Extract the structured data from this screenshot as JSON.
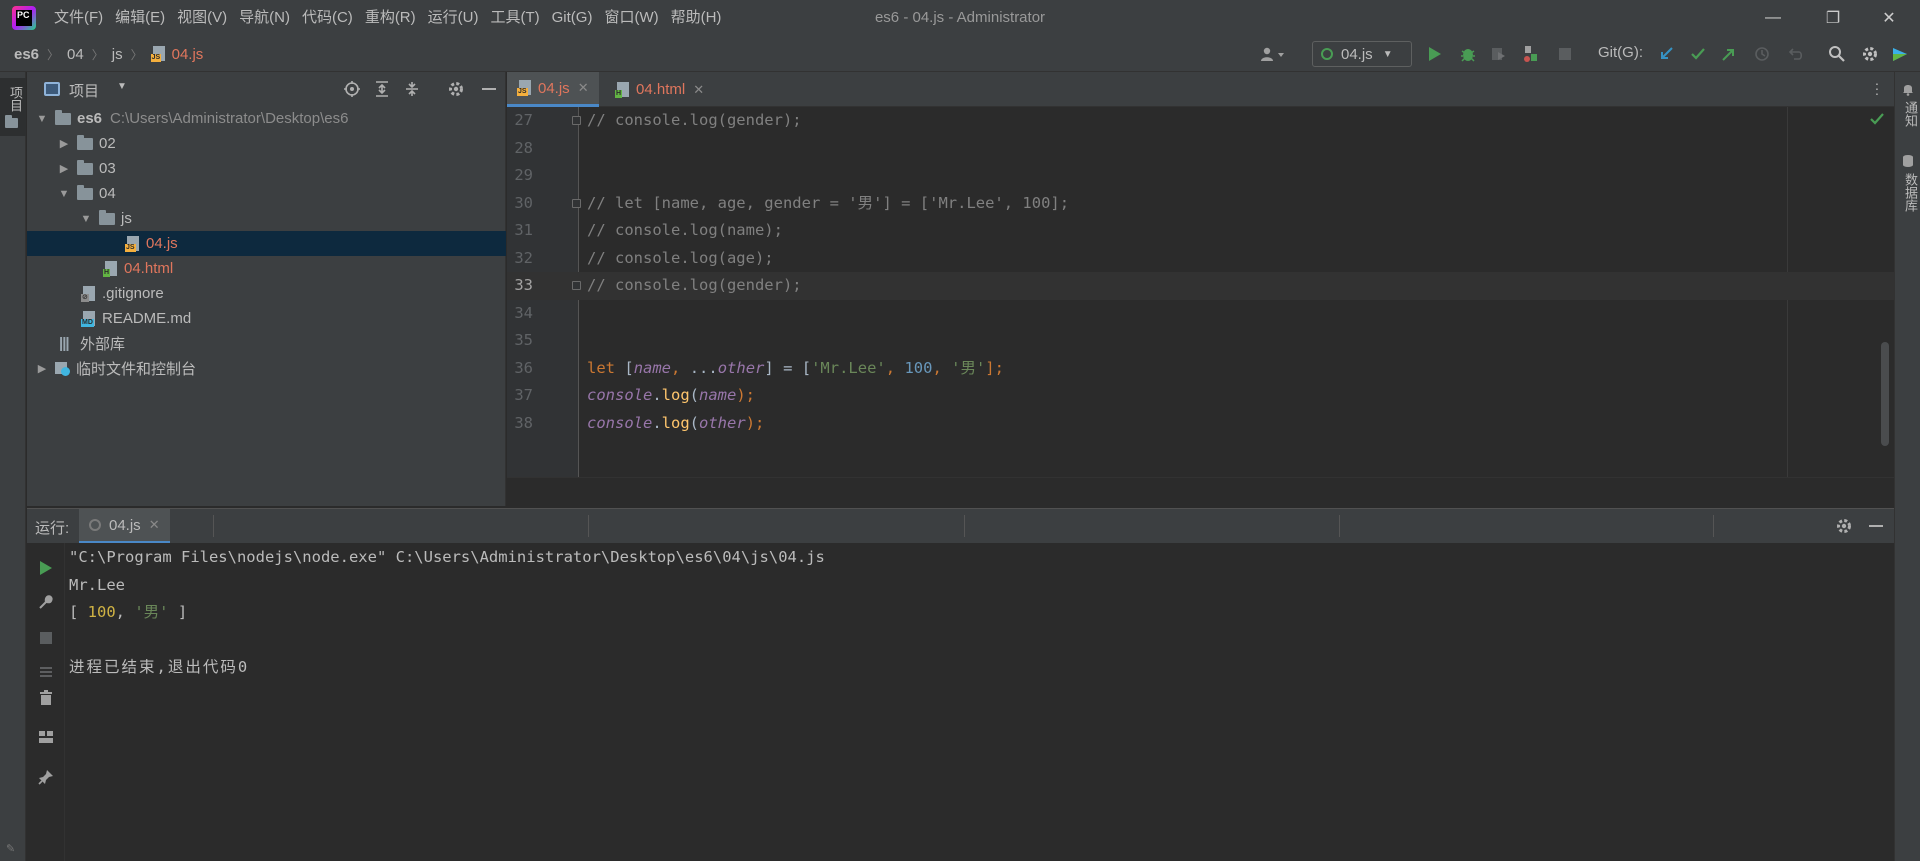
{
  "app": {
    "window_title": "es6 - 04.js - Administrator",
    "logo_text": "PC",
    "menu": [
      "文件(F)",
      "编辑(E)",
      "视图(V)",
      "导航(N)",
      "代码(C)",
      "重构(R)",
      "运行(U)",
      "工具(T)",
      "Git(G)",
      "窗口(W)",
      "帮助(H)"
    ],
    "minimize": "—",
    "restore": "❐",
    "close": "✕"
  },
  "breadcrumb": [
    "es6",
    "04",
    "js",
    "04.js"
  ],
  "toolbar": {
    "run_config": "04.js",
    "git_label": "Git(G):"
  },
  "strips": {
    "left_tab": "项目",
    "right_notifications": "通知",
    "right_database": "数据库"
  },
  "project": {
    "title": "项目",
    "tree": [
      {
        "label": "es6",
        "hint": "C:\\Users\\Administrator\\Desktop\\es6"
      },
      {
        "label": "02"
      },
      {
        "label": "03"
      },
      {
        "label": "04"
      },
      {
        "label": "js"
      },
      {
        "label": "04.js"
      },
      {
        "label": "04.html"
      },
      {
        "label": ".gitignore"
      },
      {
        "label": "README.md"
      },
      {
        "label": "外部库"
      },
      {
        "label": "临时文件和控制台"
      }
    ]
  },
  "editor": {
    "tabs": [
      "04.js",
      "04.html"
    ],
    "line_numbers": [
      "27",
      "28",
      "29",
      "30",
      "31",
      "32",
      "33",
      "34",
      "35",
      "36",
      "37",
      "38"
    ],
    "lines": [
      "// console.log(gender);",
      "",
      "",
      "// let [name, age, gender = '男'] = ['Mr.Lee', 100];",
      "// console.log(name);",
      "// console.log(age);",
      "// console.log(gender);",
      "",
      "",
      "let [name, ...other] = ['Mr.Lee', 100, '男'];",
      "console.log(name);",
      "console.log(other);"
    ],
    "current_line": "33"
  },
  "run": {
    "label": "运行:",
    "tab": "04.js",
    "output": [
      "\"C:\\Program Files\\nodejs\\node.exe\" C:\\Users\\Administrator\\Desktop\\es6\\04\\js\\04.js",
      "Mr.Lee",
      "[ 100, '男' ]",
      "",
      "进程已结束,退出代码0"
    ]
  },
  "colors": {
    "accent": "#4a88c7",
    "modified_file": "#e0765d",
    "run_green": "#499c54",
    "keyword": "#cc7832",
    "string": "#6a8759",
    "number": "#6897bb"
  }
}
